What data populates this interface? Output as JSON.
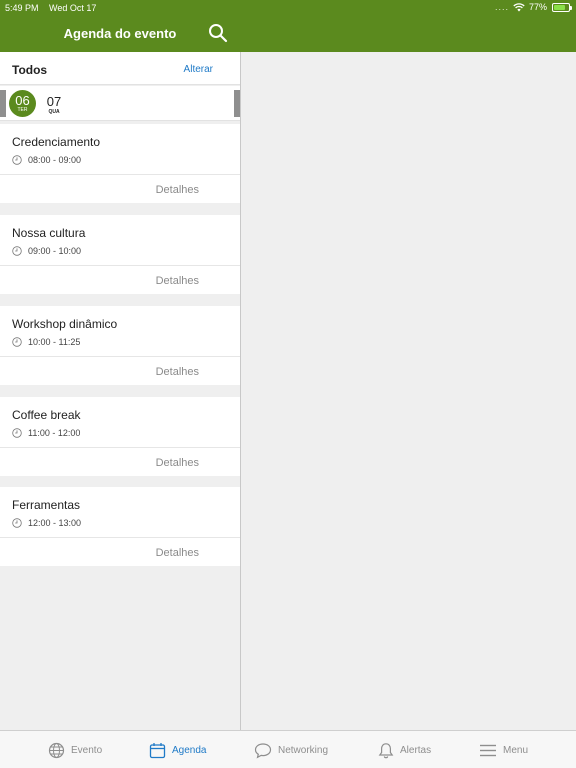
{
  "status": {
    "time": "5:49 PM",
    "date": "Wed Oct 17",
    "signal": "....",
    "battery": "77%",
    "battery_level": 0.77
  },
  "header": {
    "title": "Agenda do evento"
  },
  "filter": {
    "label": "Todos",
    "change": "Alterar"
  },
  "dates": {
    "selected": {
      "day": "06",
      "weekday": "TER"
    },
    "other": {
      "day": "07",
      "weekday": "QUA"
    }
  },
  "events": [
    {
      "title": "Credenciamento",
      "time": "08:00 - 09:00",
      "details": "Detalhes"
    },
    {
      "title": "Nossa cultura",
      "time": "09:00 - 10:00",
      "details": "Detalhes"
    },
    {
      "title": "Workshop dinâmico",
      "time": "10:00 - 11:25",
      "details": "Detalhes"
    },
    {
      "title": "Coffee break",
      "time": "11:00 - 12:00",
      "details": "Detalhes"
    },
    {
      "title": "Ferramentas",
      "time": "12:00 - 13:00",
      "details": "Detalhes"
    }
  ],
  "tabs": [
    {
      "label": "Evento",
      "icon": "globe-icon"
    },
    {
      "label": "Agenda",
      "icon": "calendar-icon",
      "active": true
    },
    {
      "label": "Networking",
      "icon": "chat-bubble-icon"
    },
    {
      "label": "Alertas",
      "icon": "bell-icon"
    },
    {
      "label": "Menu",
      "icon": "menu-icon"
    }
  ],
  "colors": {
    "brand": "#5b8a1e",
    "accent": "#1f7ac7",
    "battery": "#8be04a"
  }
}
